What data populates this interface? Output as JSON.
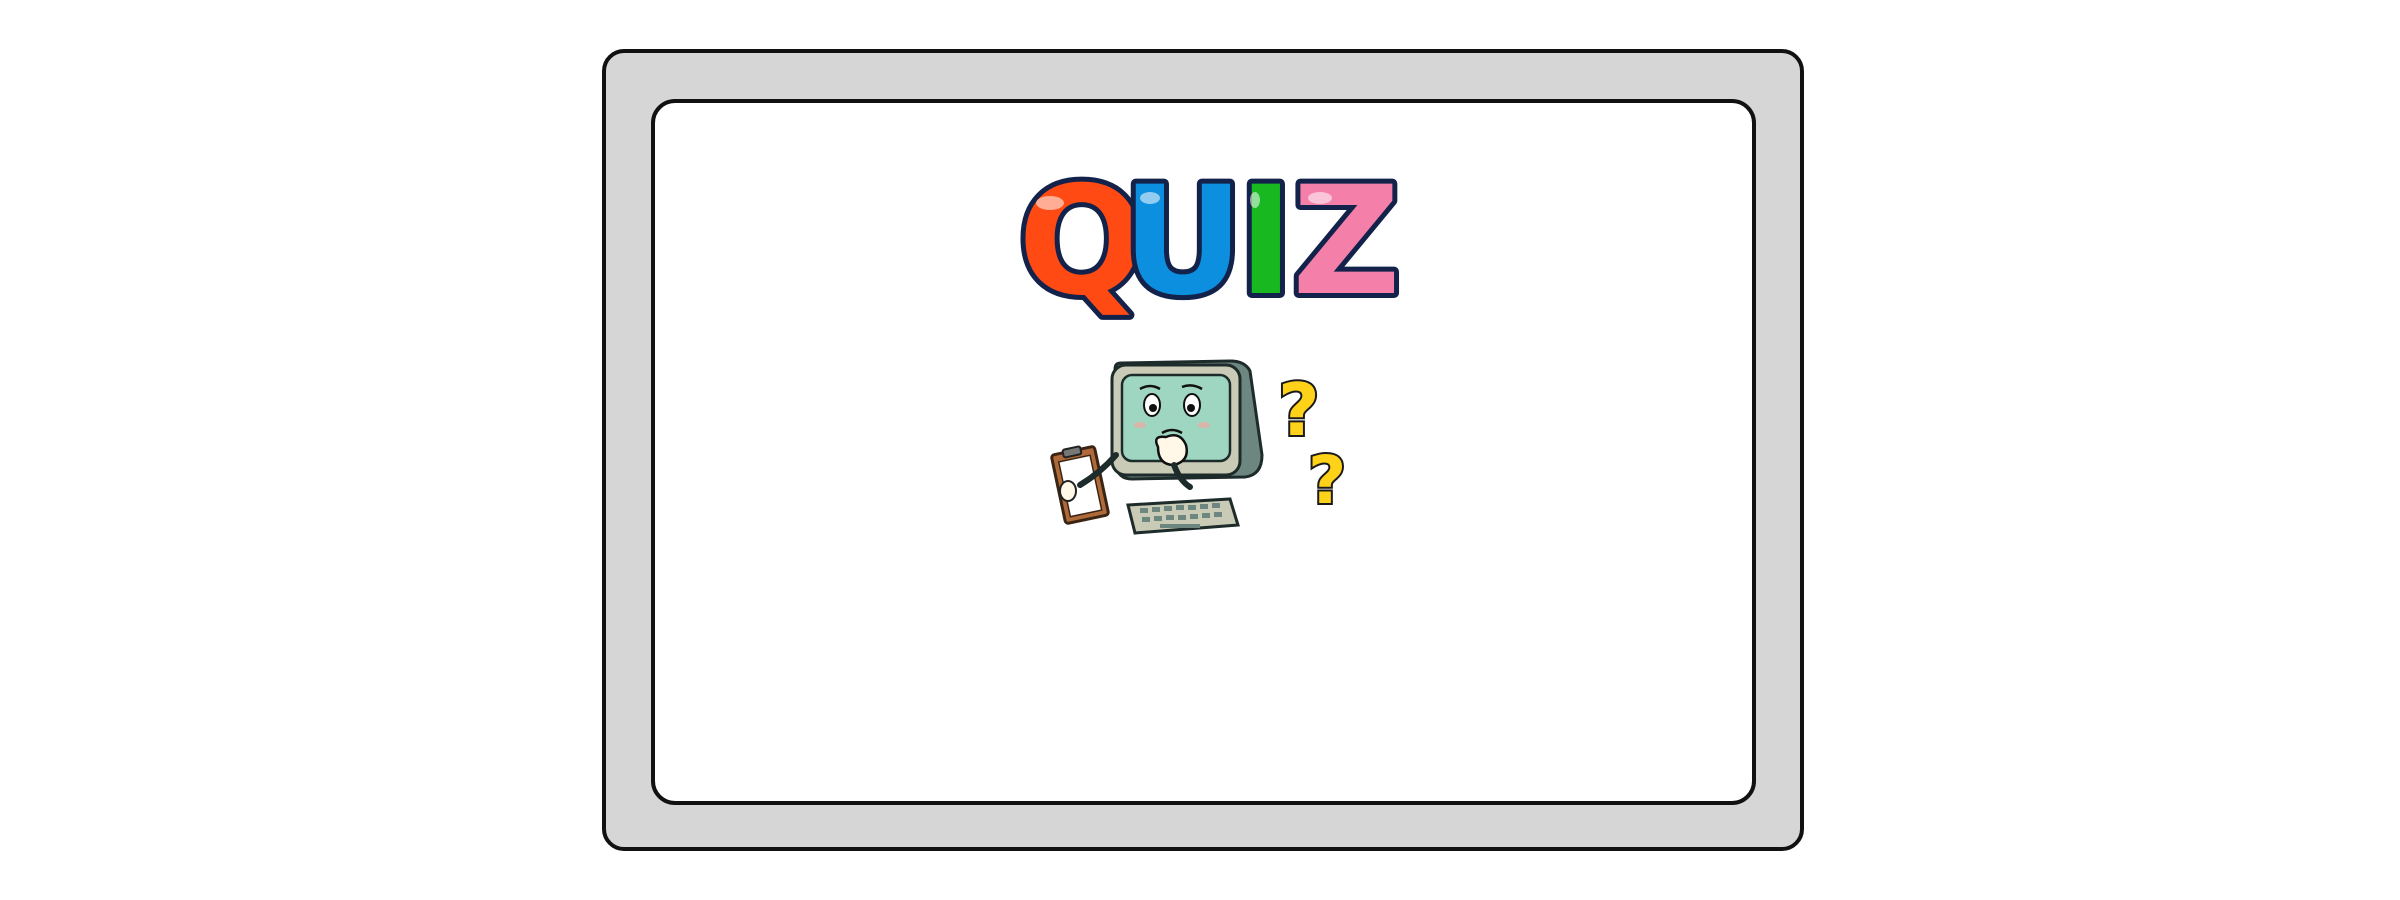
{
  "title": {
    "letters": [
      {
        "char": "Q",
        "color": "#ff4a14"
      },
      {
        "char": "U",
        "color": "#0d8fe0"
      },
      {
        "char": "I",
        "color": "#17b820"
      },
      {
        "char": "Z",
        "color": "#f47fa8"
      }
    ],
    "outline_color": "#13224a"
  },
  "illustration": {
    "icons": [
      "clipboard-icon",
      "computer-mascot-icon",
      "keyboard-icon",
      "question-mark-icon",
      "question-mark-icon"
    ],
    "accent_colors": {
      "screen": "#9fd6c2",
      "monitor": "#c9cbb6",
      "question": "#ffd21a",
      "clipboard": "#b06a3a"
    }
  }
}
